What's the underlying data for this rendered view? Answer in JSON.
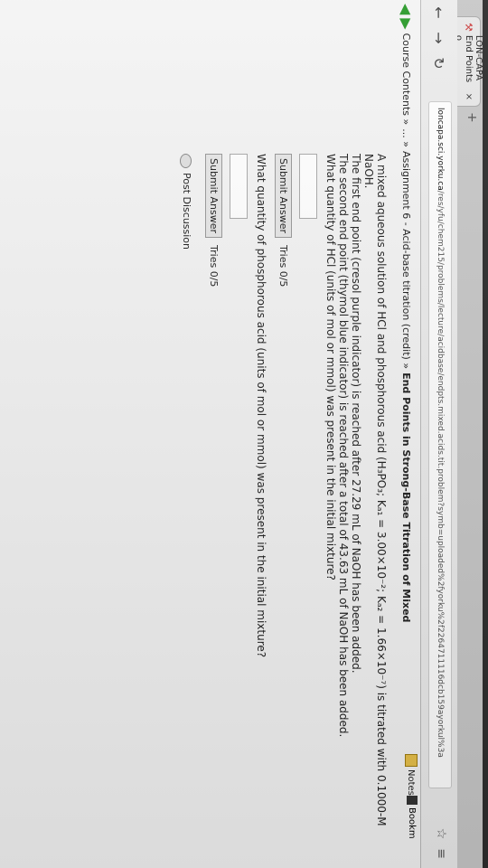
{
  "browser": {
    "tab_title": "LON-CAPA End Points o",
    "tab_close": "×",
    "new_tab": "+",
    "url_domain": "loncapa.sci.yorku.ca",
    "url_path": "/res/yfu/chem215/problems/lecture/acidbase/endpts.mixed.acids.tit.problem?symb=uploaded%2fyorku%2f2264711116dcb159ayorkul%3a"
  },
  "breadcrumbs": {
    "items": [
      "Course Contents »",
      "... »",
      "Assignment 6 - Acid-base titration (credit) »"
    ],
    "current": "End Points in Strong-Base Titration of Mixed",
    "notes_label": "Notes",
    "bookmarks_label": "Bookm"
  },
  "problem": {
    "intro_line1": "A mixed aqueous solution of HCl and phosphorous acid (H₃PO₃; Kₐ₁ = 3.00×10⁻²; Kₐ₂ = 1.66×10⁻⁷) is titrated with 0.1000-M NaOH.",
    "intro_line2": "The first end point (cresol purple indicator) is reached after 27.29 mL of NaOH has been added.",
    "intro_line3": "The second end point (thymol blue indicator) is reached after a total of 43.63 mL of NaOH has been added.",
    "question1": "What quantity of HCl (units of mol or mmol) was present in the initial mixture?",
    "submit1_label": "Submit Answer",
    "tries1": "Tries 0/5",
    "question2": "What quantity of phosphorous acid (units of mol or mmol) was present in the initial mixture?",
    "submit2_label": "Submit Answer",
    "tries2": "Tries 0/5",
    "post_discussion": "Post Discussion"
  }
}
